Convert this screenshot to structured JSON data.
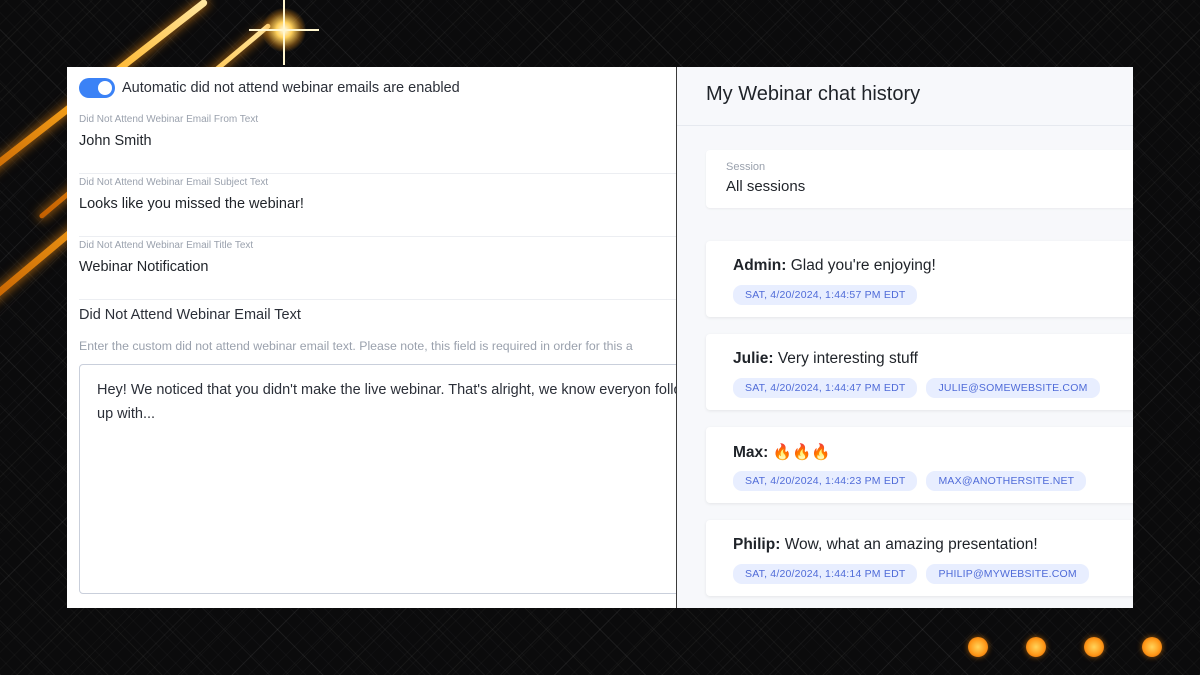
{
  "settings": {
    "toggle_label": "Automatic did not attend webinar emails are enabled",
    "toggle_on": true,
    "fields": [
      {
        "label": "Did Not Attend Webinar Email From Text",
        "value": "John Smith"
      },
      {
        "label": "Did Not Attend Webinar Email Subject Text",
        "value": "Looks like you missed the webinar!"
      },
      {
        "label": "Did Not Attend Webinar Email Title Text",
        "value": "Webinar Notification"
      }
    ],
    "email_text_title": "Did Not Attend Webinar Email Text",
    "email_text_hint": "Enter the custom did not attend webinar email text. Please note, this field is required in order for this a",
    "email_text_value": "Hey! We noticed that you didn't make the live webinar. That's alright, we know everyon follow up with..."
  },
  "chat": {
    "title": "My Webinar chat history",
    "session_label": "Session",
    "session_value": "All sessions",
    "messages": [
      {
        "author": "Admin",
        "text": "Glad you're enjoying!",
        "timestamp": "SAT, 4/20/2024, 1:44:57 PM EDT",
        "email": ""
      },
      {
        "author": "Julie",
        "text": "Very interesting stuff",
        "timestamp": "SAT, 4/20/2024, 1:44:47 PM EDT",
        "email": "JULIE@SOMEWEBSITE.COM"
      },
      {
        "author": "Max",
        "text": "🔥🔥🔥",
        "timestamp": "SAT, 4/20/2024, 1:44:23 PM EDT",
        "email": "MAX@ANOTHERSITE.NET"
      },
      {
        "author": "Philip",
        "text": "Wow, what an amazing presentation!",
        "timestamp": "SAT, 4/20/2024, 1:44:14 PM EDT",
        "email": "PHILIP@MYWEBSITE.COM"
      }
    ]
  },
  "colors": {
    "accent": "#3b82f6",
    "chip_text": "#4f6bd8",
    "chip_bg": "#e8eeff",
    "glow": "#ffb01f"
  }
}
